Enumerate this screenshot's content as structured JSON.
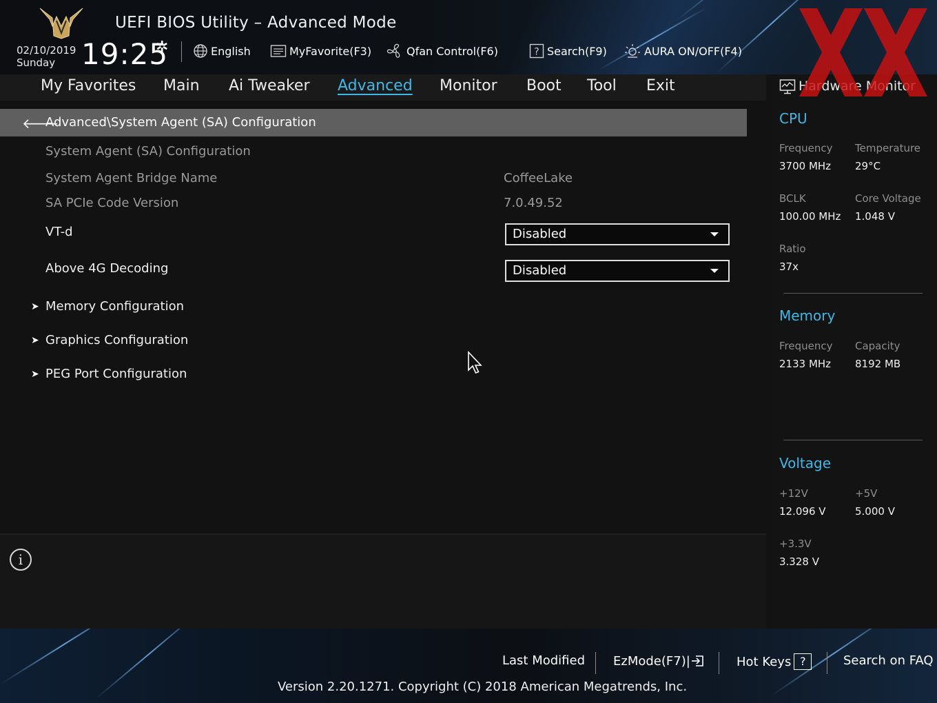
{
  "header": {
    "title": "UEFI BIOS Utility – Advanced Mode",
    "date": "02/10/2019",
    "day": "Sunday",
    "time": "19:25",
    "tools": {
      "language": "English",
      "favorite": "MyFavorite(F3)",
      "qfan": "Qfan Control(F6)",
      "search": "Search(F9)",
      "aura": "AURA ON/OFF(F4)"
    },
    "icons": [
      "tuf-logo-icon",
      "gear-icon",
      "globe-icon",
      "favorite-list-icon",
      "fan-icon",
      "help-search-icon",
      "aura-light-icon"
    ]
  },
  "nav": {
    "tabs": [
      "My Favorites",
      "Main",
      "Ai Tweaker",
      "Advanced",
      "Monitor",
      "Boot",
      "Tool",
      "Exit"
    ],
    "active": "Advanced"
  },
  "main": {
    "breadcrumb": "Advanced\\System Agent (SA) Configuration",
    "section_title": "System Agent (SA) Configuration",
    "info_rows": [
      {
        "label": "System Agent Bridge Name",
        "value": "CoffeeLake"
      },
      {
        "label": "SA PCIe Code Version",
        "value": "7.0.49.52"
      }
    ],
    "settings": [
      {
        "label": "VT-d",
        "value": "Disabled"
      },
      {
        "label": "Above 4G Decoding",
        "value": "Disabled"
      }
    ],
    "submenus": [
      "Memory Configuration",
      "Graphics Configuration",
      "PEG Port Configuration"
    ]
  },
  "hardware_monitor": {
    "title": "Hardware Monitor",
    "cpu": {
      "heading": "CPU",
      "frequency_label": "Frequency",
      "frequency": "3700 MHz",
      "temperature_label": "Temperature",
      "temperature": "29°C",
      "bclk_label": "BCLK",
      "bclk": "100.00 MHz",
      "core_voltage_label": "Core Voltage",
      "core_voltage": "1.048 V",
      "ratio_label": "Ratio",
      "ratio": "37x"
    },
    "memory": {
      "heading": "Memory",
      "frequency_label": "Frequency",
      "frequency": "2133 MHz",
      "capacity_label": "Capacity",
      "capacity": "8192 MB"
    },
    "voltage": {
      "heading": "Voltage",
      "v12_label": "+12V",
      "v12": "12.096 V",
      "v5_label": "+5V",
      "v5": "5.000 V",
      "v33_label": "+3.3V",
      "v33": "3.328 V"
    }
  },
  "footer": {
    "last_modified": "Last Modified",
    "ezmode": "EzMode(F7)|",
    "hot_keys": "Hot Keys",
    "faq": "Search on FAQ",
    "version": "Version 2.20.1271. Copyright (C) 2018 American Megatrends, Inc."
  },
  "colors": {
    "accent": "#3fb8e8",
    "watermark": "#cc1111",
    "breadcrumb_bar": "#5f5f5f"
  }
}
